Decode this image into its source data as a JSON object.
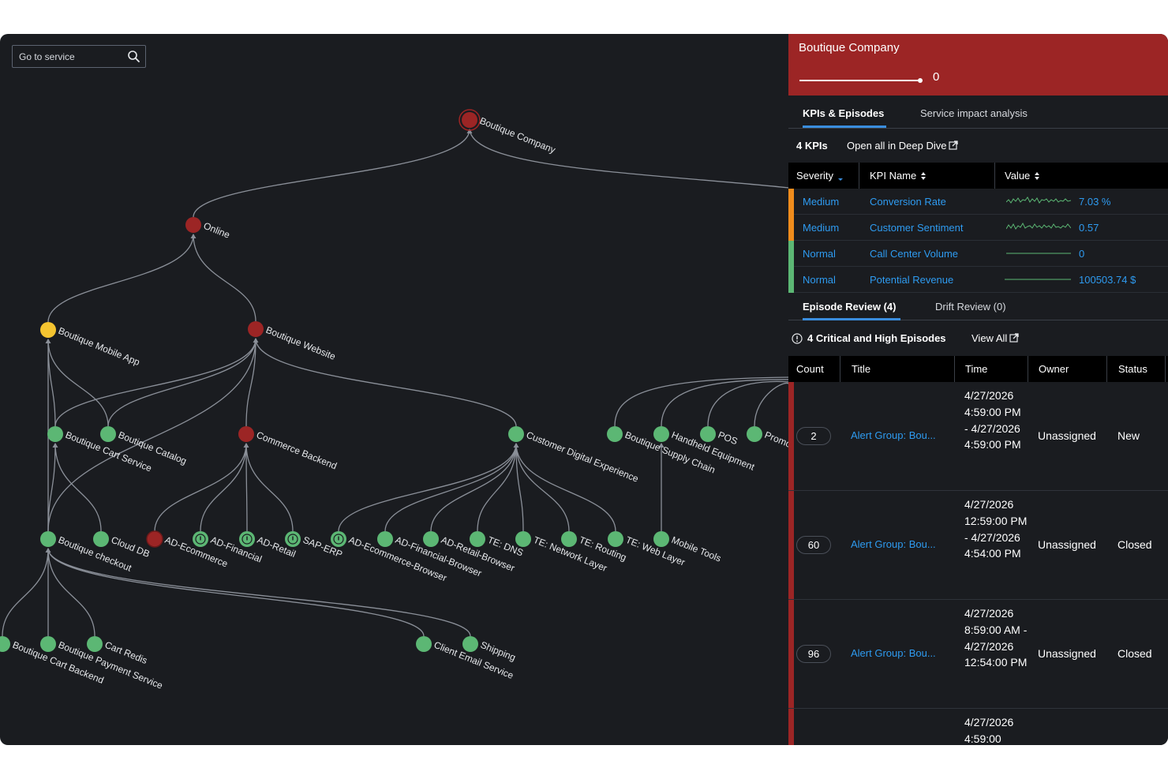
{
  "search": {
    "placeholder": "Go to service"
  },
  "map": {
    "nodes": [
      {
        "id": "company",
        "label": "Boutique Company",
        "status": "critical-root"
      },
      {
        "id": "online",
        "label": "Online",
        "status": "critical"
      },
      {
        "id": "mobile",
        "label": "Boutique Mobile App",
        "status": "medium"
      },
      {
        "id": "website",
        "label": "Boutique Website",
        "status": "critical"
      },
      {
        "id": "cart",
        "label": "Boutique Cart Service",
        "status": "normal"
      },
      {
        "id": "catalog",
        "label": "Boutique Catalog",
        "status": "normal"
      },
      {
        "id": "commerce",
        "label": "Commerce Backend",
        "status": "critical"
      },
      {
        "id": "cde",
        "label": "Customer Digital Experience",
        "status": "normal"
      },
      {
        "id": "supply",
        "label": "Boutique Supply Chain",
        "status": "normal"
      },
      {
        "id": "handheld",
        "label": "Handheld Equipment",
        "status": "normal"
      },
      {
        "id": "pos",
        "label": "POS",
        "status": "normal"
      },
      {
        "id": "promo",
        "label": "Promo",
        "status": "normal"
      },
      {
        "id": "checkout",
        "label": "Boutique checkout",
        "status": "normal"
      },
      {
        "id": "clouddb",
        "label": "Cloud DB",
        "status": "normal"
      },
      {
        "id": "adecom",
        "label": "AD-Ecommerce",
        "status": "critical-dark"
      },
      {
        "id": "adfin",
        "label": "AD-Financial",
        "status": "info"
      },
      {
        "id": "adret",
        "label": "AD-Retail",
        "status": "info"
      },
      {
        "id": "saperp",
        "label": "SAP-ERP",
        "status": "info"
      },
      {
        "id": "adecb",
        "label": "AD-Ecommerce-Browser",
        "status": "info"
      },
      {
        "id": "adfb",
        "label": "AD-Financial-Browser",
        "status": "normal"
      },
      {
        "id": "adrb",
        "label": "AD-Retail-Browser",
        "status": "normal"
      },
      {
        "id": "tedns",
        "label": "TE: DNS",
        "status": "normal"
      },
      {
        "id": "tenet",
        "label": "TE: Network Layer",
        "status": "normal"
      },
      {
        "id": "terout",
        "label": "TE: Routing",
        "status": "normal"
      },
      {
        "id": "teweb",
        "label": "TE: Web Layer",
        "status": "normal"
      },
      {
        "id": "mtools",
        "label": "Mobile Tools",
        "status": "normal"
      },
      {
        "id": "cartbe",
        "label": "Boutique Cart Backend",
        "status": "normal"
      },
      {
        "id": "pay",
        "label": "Boutique Payment Service",
        "status": "normal"
      },
      {
        "id": "redis",
        "label": "Cart Redis",
        "status": "normal"
      },
      {
        "id": "email",
        "label": "Client Email Service",
        "status": "normal"
      },
      {
        "id": "ship",
        "label": "Shipping",
        "status": "normal"
      }
    ],
    "colors": {
      "critical": "#9c2525",
      "medium": "#f4c430",
      "normal": "#5cb774",
      "edge": "#8b9099"
    }
  },
  "panel": {
    "title": "Boutique Company",
    "health_score": "0",
    "tabs": [
      "KPIs & Episodes",
      "Service impact analysis"
    ],
    "kpi_count": "4 KPIs",
    "deep_dive": "Open all in Deep Dive",
    "kpi_headers": [
      "Severity",
      "KPI Name",
      "Value"
    ],
    "kpis": [
      {
        "severity": "Medium",
        "name": "Conversion Rate",
        "value": "7.03 %",
        "color": "#f08c1c"
      },
      {
        "severity": "Medium",
        "name": "Customer Sentiment",
        "value": "0.57",
        "color": "#f08c1c"
      },
      {
        "severity": "Normal",
        "name": "Call Center Volume",
        "value": "0",
        "color": "#5cb774"
      },
      {
        "severity": "Normal",
        "name": "Potential Revenue",
        "value": "100503.74 $",
        "color": "#5cb774"
      }
    ],
    "review_tabs": [
      "Episode Review (4)",
      "Drift Review (0)"
    ],
    "episodes_summary": "4 Critical and High Episodes",
    "view_all": "View All",
    "episode_headers": [
      "Count",
      "Title",
      "Time",
      "Owner",
      "Status"
    ],
    "episodes": [
      {
        "count": "2",
        "title": "Alert Group: Bou...",
        "time": "4/27/2026 4:59:00 PM - 4/27/2026 4:59:00 PM",
        "owner": "Unassigned",
        "status": "New"
      },
      {
        "count": "60",
        "title": "Alert Group: Bou...",
        "time": "4/27/2026 12:59:00 PM - 4/27/2026 4:54:00 PM",
        "owner": "Unassigned",
        "status": "Closed"
      },
      {
        "count": "96",
        "title": "Alert Group: Bou...",
        "time": "4/27/2026 8:59:00 AM - 4/27/2026 12:54:00 PM",
        "owner": "Unassigned",
        "status": "Closed"
      },
      {
        "count": "",
        "title": "",
        "time": "4/27/2026 4:59:00",
        "owner": "",
        "status": ""
      }
    ]
  }
}
